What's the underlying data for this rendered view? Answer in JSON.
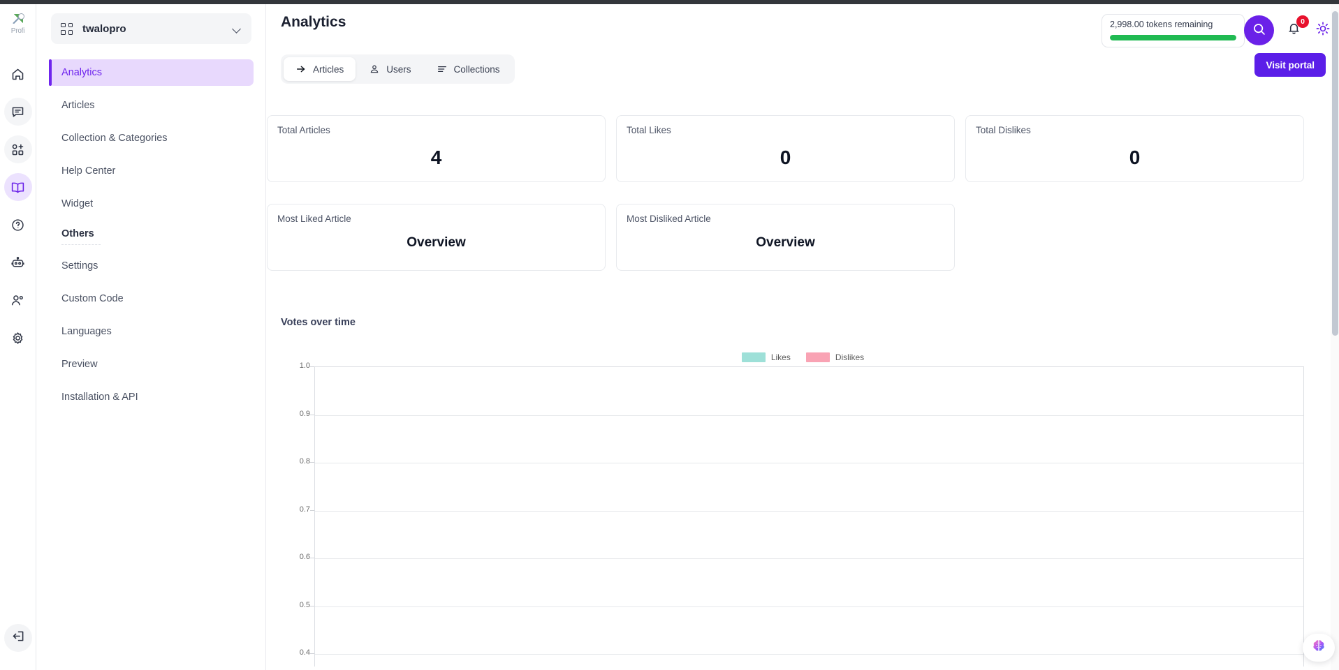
{
  "app": {
    "logo_alt": "Profi",
    "workspace_name": "twalopro"
  },
  "rail": {
    "items": [
      {
        "name": "home-icon",
        "label": "Home"
      },
      {
        "name": "chat-icon",
        "label": "Inbox"
      },
      {
        "name": "apps-add-icon",
        "label": "Apps"
      },
      {
        "name": "book-icon",
        "label": "Knowledge Base"
      },
      {
        "name": "help-circle-icon",
        "label": "Help"
      },
      {
        "name": "robot-icon",
        "label": "Bot"
      },
      {
        "name": "people-icon",
        "label": "Contacts"
      },
      {
        "name": "gear-icon",
        "label": "Settings"
      }
    ],
    "logout_label": "Logout"
  },
  "sidebar": {
    "items": [
      {
        "label": "Analytics",
        "active": true
      },
      {
        "label": "Articles",
        "active": false
      },
      {
        "label": "Collection & Categories",
        "active": false
      },
      {
        "label": "Help Center",
        "active": false
      },
      {
        "label": "Widget",
        "active": false
      }
    ],
    "section_label": "Others",
    "others": [
      {
        "label": "Settings"
      },
      {
        "label": "Custom Code"
      },
      {
        "label": "Languages"
      },
      {
        "label": "Preview"
      },
      {
        "label": "Installation & API"
      }
    ]
  },
  "header": {
    "title": "Analytics",
    "tokens_text": "2,998.00 tokens remaining",
    "tokens_progress_percent": 100,
    "tokens_bar_color": "#20ba52",
    "notification_count": "0",
    "search_label": "Search",
    "theme_label": "Toggle theme",
    "visit_portal_label": "Visit portal",
    "accent_color": "#5b1ee8"
  },
  "tabs": [
    {
      "label": "Articles",
      "icon": "arrow-icon",
      "active": true
    },
    {
      "label": "Users",
      "icon": "user-icon",
      "active": false
    },
    {
      "label": "Collections",
      "icon": "lines-icon",
      "active": false
    }
  ],
  "stats": [
    {
      "label": "Total Articles",
      "value": "4"
    },
    {
      "label": "Total Likes",
      "value": "0"
    },
    {
      "label": "Total Dislikes",
      "value": "0"
    }
  ],
  "article_stats": [
    {
      "label": "Most Liked Article",
      "value": "Overview"
    },
    {
      "label": "Most Disliked Article",
      "value": "Overview"
    }
  ],
  "chart_data": {
    "type": "line",
    "title": "Votes over time",
    "xlabel": "",
    "ylabel": "",
    "ylim": [
      0.4,
      1.0
    ],
    "yticks": [
      "1.0",
      "0.9",
      "0.8",
      "0.7",
      "0.6",
      "0.5",
      "0.4"
    ],
    "x": [],
    "grid": true,
    "legend_position": "top-center",
    "series": [
      {
        "name": "Likes",
        "color": "#9ee0d8",
        "values": []
      },
      {
        "name": "Dislikes",
        "color": "#f9a3b4",
        "values": []
      }
    ]
  },
  "widget": {
    "ai_label": "AI Assistant"
  }
}
